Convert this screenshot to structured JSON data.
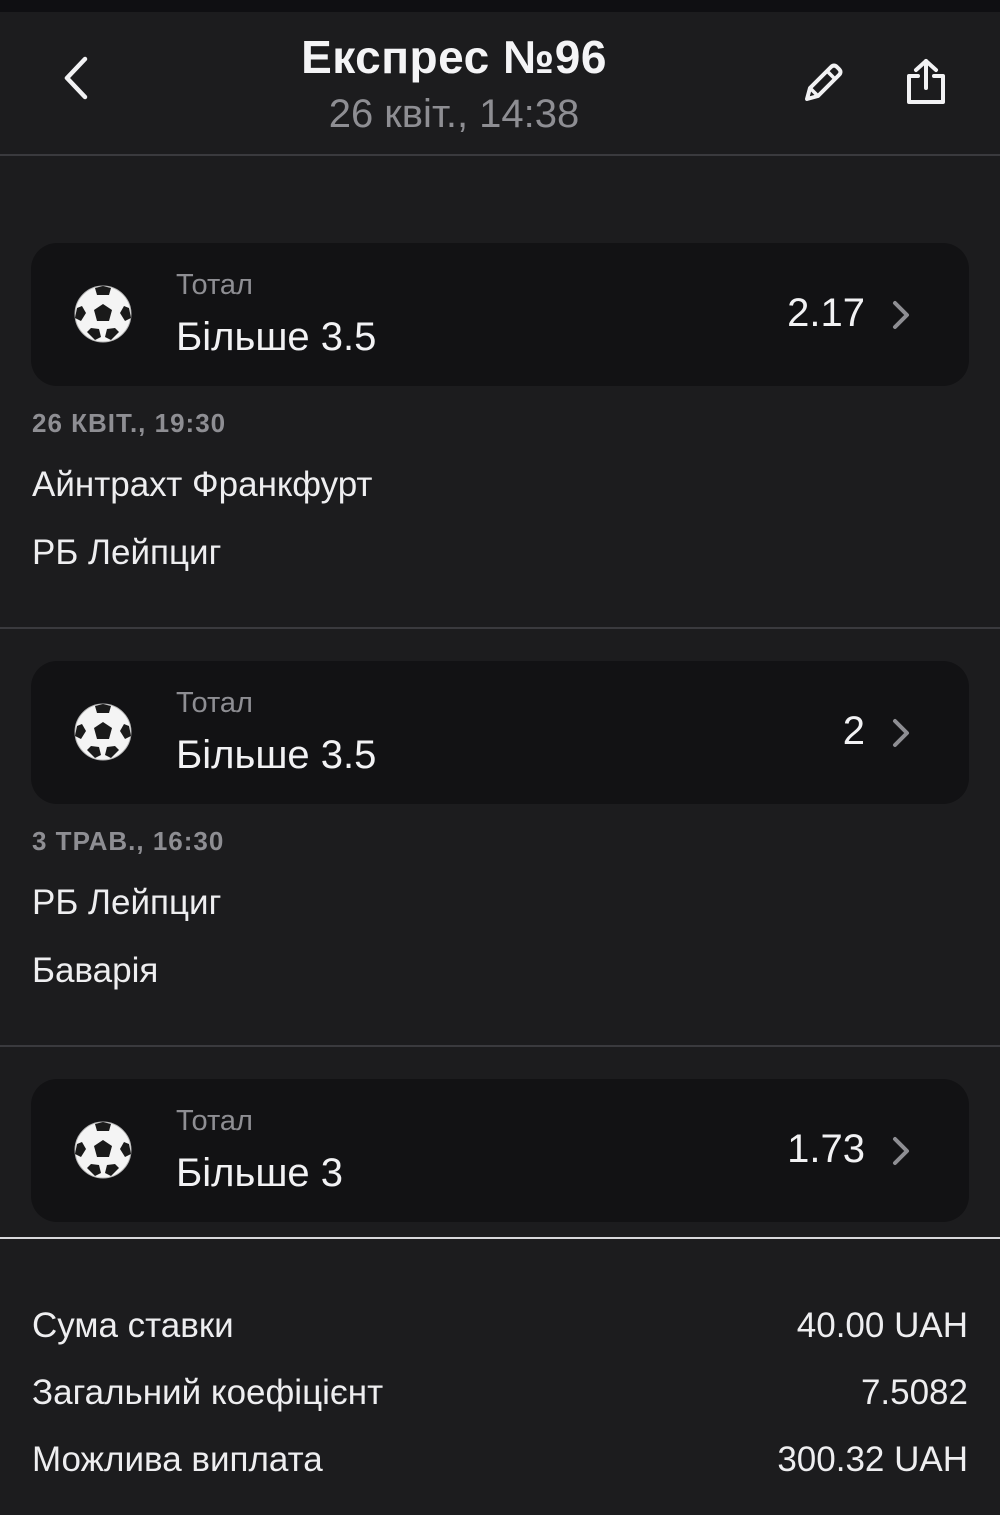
{
  "header": {
    "title": "Експрес №96",
    "subtitle": "26 квіт., 14:38",
    "back_icon": "chevron-left-icon",
    "edit_icon": "pencil-icon",
    "share_icon": "share-icon"
  },
  "events": [
    {
      "market": "Тотал",
      "selection": "Більше 3.5",
      "odds": "2.17",
      "date": "26 КВІТ., 19:30",
      "home": "Айнтрахт Франкфурт",
      "away": "РБ Лейпциг",
      "icon": "soccer-ball-icon"
    },
    {
      "market": "Тотал",
      "selection": "Більше 3.5",
      "odds": "2",
      "date": "3 ТРАВ., 16:30",
      "home": "РБ Лейпциг",
      "away": "Баварія",
      "icon": "soccer-ball-icon"
    },
    {
      "market": "Тотал",
      "selection": "Більше 3",
      "odds": "1.73",
      "icon": "soccer-ball-icon"
    }
  ],
  "summary": {
    "stake_label": "Сума ставки",
    "stake_value": "40.00 UAH",
    "coef_label": "Загальний коефіцієнт",
    "coef_value": "7.5082",
    "payout_label": "Можлива виплата",
    "payout_value": "300.32 UAH"
  },
  "colors": {
    "background": "#1c1c1e",
    "card": "#121214",
    "secondary_text": "#8e8e93",
    "primary_text": "#f2f2f4"
  }
}
